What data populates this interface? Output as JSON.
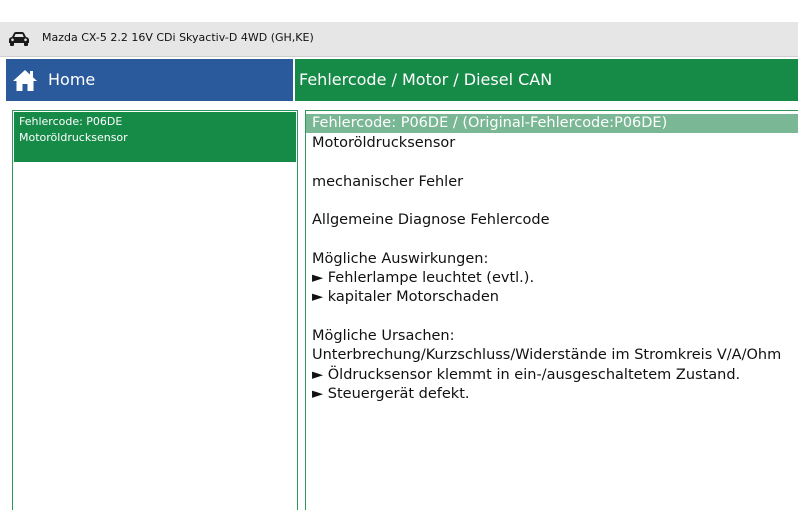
{
  "vehicle": {
    "title": "Mazda CX-5 2.2 16V CDi Skyactiv-D 4WD (GH,KE)",
    "icon": "car-icon"
  },
  "header": {
    "home_label": "Home",
    "home_icon": "home-icon",
    "breadcrumb": "Fehlercode / Motor / Diesel CAN"
  },
  "fault_list": [
    {
      "code": "Fehlercode: P06DE",
      "description": "Motoröldrucksensor"
    }
  ],
  "detail": {
    "heading": "Fehlercode: P06DE / (Original-Fehlercode:P06DE)",
    "name": "Motoröldrucksensor",
    "type": "mechanischer Fehler",
    "category": "Allgemeine Diagnose Fehlercode",
    "effects_title": "Mögliche Auswirkungen:",
    "effects": [
      "► Fehlerlampe leuchtet (evtl.).",
      "► kapitaler Motorschaden"
    ],
    "causes_title": "Mögliche Ursachen:",
    "causes": [
      "Unterbrechung/Kurzschluss/Widerstände im Stromkreis V/A/Ohm",
      "► Öldrucksensor klemmt in ein-/ausgeschaltetem Zustand.",
      "► Steuergerät defekt."
    ]
  },
  "colors": {
    "home_blue": "#2a5a9b",
    "accent_green": "#168b48",
    "heading_green": "#7ab794",
    "bar_gray": "#e6e6e6"
  }
}
